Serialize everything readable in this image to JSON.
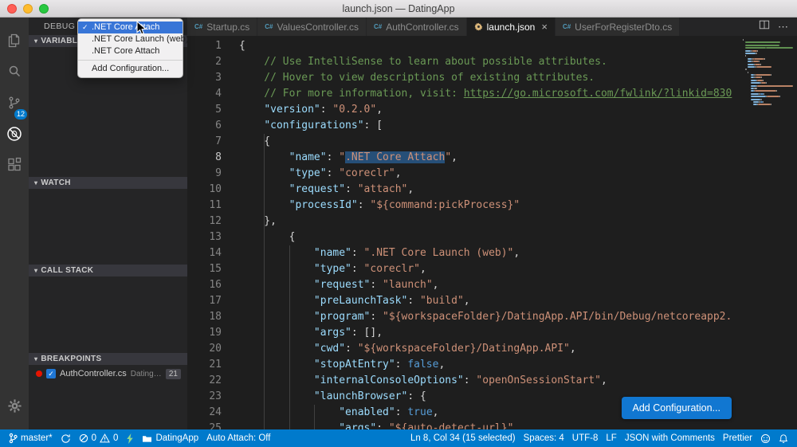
{
  "titlebar": {
    "title": "launch.json — DatingApp"
  },
  "glyphs": {
    "check": "✓",
    "close": "×",
    "more": "⋯",
    "chevron": "▾",
    "play": "▶"
  },
  "colors": {
    "status_bar": "#007acc",
    "selection": "#264f78",
    "button_blue": "#1177d1",
    "badge_blue": "#007acc",
    "breakpoint_red": "#e51400"
  },
  "activity_bar": {
    "scm_badge": "12"
  },
  "sidebar": {
    "panel_title": "DEBUG",
    "sections": [
      {
        "label": "VARIABLES"
      },
      {
        "label": "WATCH"
      },
      {
        "label": "CALL STACK"
      },
      {
        "label": "BREAKPOINTS"
      }
    ],
    "breakpoint": {
      "file": "AuthController.cs",
      "path": "DatingApp...",
      "line": "21"
    }
  },
  "config_dropdown": {
    "items": [
      {
        "label": ".NET Core Attach",
        "checked": true,
        "selected": true
      },
      {
        "label": ".NET Core Launch (web)"
      },
      {
        "label": ".NET Core Attach"
      },
      {
        "label": "Add Configuration...",
        "separator_before": true
      }
    ]
  },
  "tabs": {
    "items": [
      {
        "label": "Startup.cs",
        "icon": "csharp"
      },
      {
        "label": "ValuesController.cs",
        "icon": "csharp"
      },
      {
        "label": "AuthController.cs",
        "icon": "csharp"
      },
      {
        "label": "launch.json",
        "icon": "gear",
        "active": true
      },
      {
        "label": "UserForRegisterDto.cs",
        "icon": "csharp"
      }
    ]
  },
  "editor": {
    "add_config_button": "Add Configuration...",
    "active_line": 8,
    "lines": [
      {
        "n": 1,
        "toks": [
          [
            "p",
            "{"
          ]
        ]
      },
      {
        "n": 2,
        "toks": [
          [
            "c",
            "    // Use IntelliSense to learn about possible attributes."
          ]
        ]
      },
      {
        "n": 3,
        "toks": [
          [
            "c",
            "    // Hover to view descriptions of existing attributes."
          ]
        ]
      },
      {
        "n": 4,
        "toks": [
          [
            "c",
            "    // For more information, visit: "
          ],
          [
            "lnk",
            "https://go.microsoft.com/fwlink/?linkid=830"
          ]
        ]
      },
      {
        "n": 5,
        "toks": [
          [
            "p",
            "    "
          ],
          [
            "k",
            "\"version\""
          ],
          [
            "p",
            ": "
          ],
          [
            "s",
            "\"0.2.0\""
          ],
          [
            "p",
            ","
          ]
        ]
      },
      {
        "n": 6,
        "toks": [
          [
            "p",
            "    "
          ],
          [
            "k",
            "\"configurations\""
          ],
          [
            "p",
            ": ["
          ]
        ]
      },
      {
        "n": 7,
        "toks": [
          [
            "p",
            "    {"
          ]
        ]
      },
      {
        "n": 8,
        "toks": [
          [
            "p",
            "        "
          ],
          [
            "k",
            "\"name\""
          ],
          [
            "p",
            ": "
          ],
          [
            "s",
            "\""
          ],
          [
            "s-sel",
            ".NET Core Attach"
          ],
          [
            "s",
            "\""
          ],
          [
            "p",
            ","
          ]
        ]
      },
      {
        "n": 9,
        "toks": [
          [
            "p",
            "        "
          ],
          [
            "k",
            "\"type\""
          ],
          [
            "p",
            ": "
          ],
          [
            "s",
            "\"coreclr\""
          ],
          [
            "p",
            ","
          ]
        ]
      },
      {
        "n": 10,
        "toks": [
          [
            "p",
            "        "
          ],
          [
            "k",
            "\"request\""
          ],
          [
            "p",
            ": "
          ],
          [
            "s",
            "\"attach\""
          ],
          [
            "p",
            ","
          ]
        ]
      },
      {
        "n": 11,
        "toks": [
          [
            "p",
            "        "
          ],
          [
            "k",
            "\"processId\""
          ],
          [
            "p",
            ": "
          ],
          [
            "s",
            "\"${command:pickProcess}\""
          ]
        ]
      },
      {
        "n": 12,
        "toks": [
          [
            "p",
            "    },"
          ]
        ]
      },
      {
        "n": 13,
        "toks": [
          [
            "p",
            "        {"
          ]
        ]
      },
      {
        "n": 14,
        "toks": [
          [
            "p",
            "            "
          ],
          [
            "k",
            "\"name\""
          ],
          [
            "p",
            ": "
          ],
          [
            "s",
            "\".NET Core Launch (web)\""
          ],
          [
            "p",
            ","
          ]
        ]
      },
      {
        "n": 15,
        "toks": [
          [
            "p",
            "            "
          ],
          [
            "k",
            "\"type\""
          ],
          [
            "p",
            ": "
          ],
          [
            "s",
            "\"coreclr\""
          ],
          [
            "p",
            ","
          ]
        ]
      },
      {
        "n": 16,
        "toks": [
          [
            "p",
            "            "
          ],
          [
            "k",
            "\"request\""
          ],
          [
            "p",
            ": "
          ],
          [
            "s",
            "\"launch\""
          ],
          [
            "p",
            ","
          ]
        ]
      },
      {
        "n": 17,
        "toks": [
          [
            "p",
            "            "
          ],
          [
            "k",
            "\"preLaunchTask\""
          ],
          [
            "p",
            ": "
          ],
          [
            "s",
            "\"build\""
          ],
          [
            "p",
            ","
          ]
        ]
      },
      {
        "n": 18,
        "toks": [
          [
            "p",
            "            "
          ],
          [
            "k",
            "\"program\""
          ],
          [
            "p",
            ": "
          ],
          [
            "s",
            "\"${workspaceFolder}/DatingApp.API/bin/Debug/netcoreapp2."
          ]
        ]
      },
      {
        "n": 19,
        "toks": [
          [
            "p",
            "            "
          ],
          [
            "k",
            "\"args\""
          ],
          [
            "p",
            ": [],"
          ]
        ]
      },
      {
        "n": 20,
        "toks": [
          [
            "p",
            "            "
          ],
          [
            "k",
            "\"cwd\""
          ],
          [
            "p",
            ": "
          ],
          [
            "s",
            "\"${workspaceFolder}/DatingApp.API\""
          ],
          [
            "p",
            ","
          ]
        ]
      },
      {
        "n": 21,
        "toks": [
          [
            "p",
            "            "
          ],
          [
            "k",
            "\"stopAtEntry\""
          ],
          [
            "p",
            ": "
          ],
          [
            "b",
            "false"
          ],
          [
            "p",
            ","
          ]
        ]
      },
      {
        "n": 22,
        "toks": [
          [
            "p",
            "            "
          ],
          [
            "k",
            "\"internalConsoleOptions\""
          ],
          [
            "p",
            ": "
          ],
          [
            "s",
            "\"openOnSessionStart\""
          ],
          [
            "p",
            ","
          ]
        ]
      },
      {
        "n": 23,
        "toks": [
          [
            "p",
            "            "
          ],
          [
            "k",
            "\"launchBrowser\""
          ],
          [
            "p",
            ": {"
          ]
        ]
      },
      {
        "n": 24,
        "toks": [
          [
            "p",
            "                "
          ],
          [
            "k",
            "\"enabled\""
          ],
          [
            "p",
            ": "
          ],
          [
            "b",
            "true"
          ],
          [
            "p",
            ","
          ]
        ]
      },
      {
        "n": 25,
        "toks": [
          [
            "p",
            "                "
          ],
          [
            "k",
            "\"args\""
          ],
          [
            "p",
            ": "
          ],
          [
            "s",
            "\"${auto-detect-url}\""
          ],
          [
            "p",
            ","
          ]
        ]
      }
    ]
  },
  "status_bar": {
    "branch": "master*",
    "errors": "0",
    "warnings": "0",
    "folder": "DatingApp",
    "auto_attach": "Auto Attach: Off",
    "cursor": "Ln 8, Col 34 (15 selected)",
    "indentation": "Spaces: 4",
    "encoding": "UTF-8",
    "eol": "LF",
    "language": "JSON with Comments",
    "formatter": "Prettier"
  }
}
